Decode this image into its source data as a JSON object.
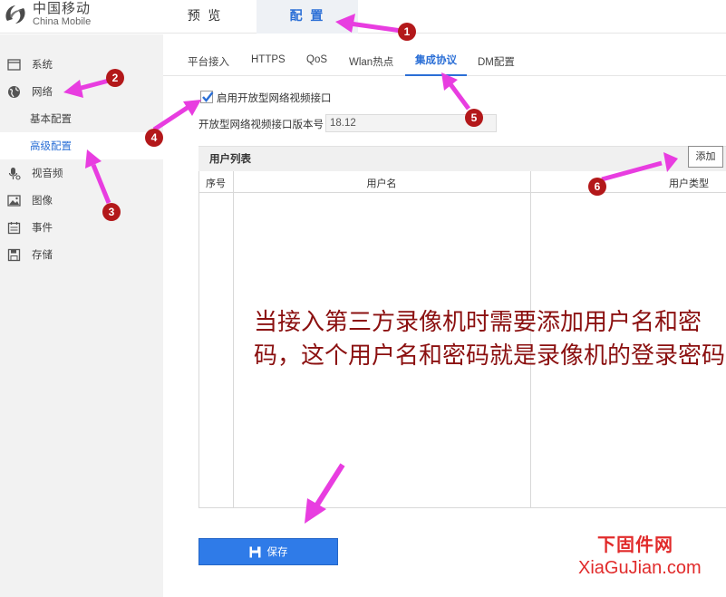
{
  "logo": {
    "cn": "中国移动",
    "en": "China Mobile"
  },
  "top_tabs": [
    {
      "label": "预 览"
    },
    {
      "label": "配 置",
      "active": true
    }
  ],
  "sidebar": {
    "items": [
      {
        "label": "系统",
        "icon": "window-icon"
      },
      {
        "label": "网络",
        "icon": "globe-icon"
      },
      {
        "label": "视音频",
        "icon": "microphone-icon"
      },
      {
        "label": "图像",
        "icon": "image-icon"
      },
      {
        "label": "事件",
        "icon": "calendar-icon"
      },
      {
        "label": "存储",
        "icon": "floppy-icon"
      }
    ],
    "sub_items": [
      {
        "label": "基本配置"
      },
      {
        "label": "高级配置",
        "active": true
      }
    ]
  },
  "protocol_tabs": [
    "平台接入",
    "HTTPS",
    "QoS",
    "Wlan热点",
    "集成协议",
    "DM配置"
  ],
  "active_protocol_tab": "集成协议",
  "enable_open_video": {
    "label": "启用开放型网络视频接口",
    "checked": true
  },
  "version": {
    "label": "开放型网络视频接口版本号",
    "value": "18.12"
  },
  "user_table": {
    "title": "用户列表",
    "add_label": "添加",
    "columns": [
      "序号",
      "用户名",
      "用户类型"
    ],
    "rows": []
  },
  "note_text": "当接入第三方录像机时需要添加用户名和密码，这个用户名和密码就是录像机的登录密码",
  "save_label": "保存",
  "watermark": {
    "cn": "下固件网",
    "en": "XiaGuJian.com"
  },
  "badges": [
    "1",
    "2",
    "3",
    "4",
    "5",
    "6"
  ],
  "colors": {
    "accent": "#2b6fd6",
    "save_button": "#2f7be8",
    "annotation": "#e83de0",
    "badge": "#b3181a",
    "note": "#8b1010",
    "watermark": "#e12b2b"
  }
}
